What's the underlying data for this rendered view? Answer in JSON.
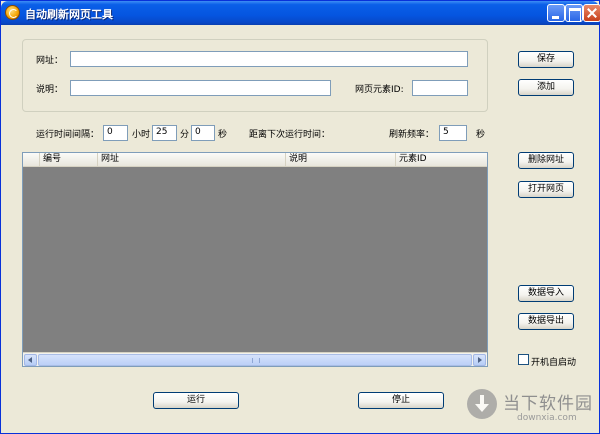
{
  "window": {
    "title": "自动刷新网页工具"
  },
  "form": {
    "url_label": "网址：",
    "url_value": "",
    "desc_label": "说明：",
    "desc_value": "",
    "element_id_label": "网页元素ID:",
    "element_id_value": ""
  },
  "buttons": {
    "save": "保存",
    "add": "添加",
    "delete_url": "删除网址",
    "open_page": "打开网页",
    "import_data": "数据导入",
    "export_data": "数据导出",
    "run": "运行",
    "stop": "停止"
  },
  "timing": {
    "interval_label": "运行时间间隔：",
    "hours_value": "0",
    "hours_unit": "小时",
    "minutes_value": "25",
    "minutes_unit": "分",
    "seconds_value": "0",
    "seconds_unit": "秒",
    "next_run_label": "距离下次运行时间：",
    "refresh_rate_label": "刷新频率：",
    "refresh_rate_value": "5",
    "refresh_rate_unit": "秒"
  },
  "table": {
    "columns": [
      "编号",
      "网址",
      "说明",
      "元素ID"
    ],
    "rows": []
  },
  "autostart": {
    "label": "开机自启动",
    "checked": false
  },
  "watermark": {
    "text": "当下软件园",
    "sub": "downxia.com"
  },
  "colors": {
    "title_bar": "#0555e0",
    "window_bg": "#ece9d8",
    "list_bg": "#808080"
  }
}
